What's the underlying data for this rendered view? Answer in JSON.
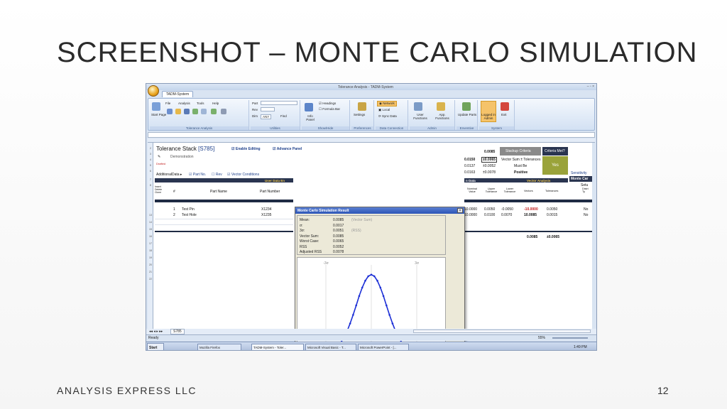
{
  "slide": {
    "title": "SCREENSHOT – MONTE CARLO SIMULATION",
    "footer_left": "ANALYSIS EXPRESS LLC",
    "page_number": "12"
  },
  "window": {
    "title": "Tolerance Analysis - TADM-System"
  },
  "ribbon": {
    "tab": "TADM-System",
    "menus": [
      "File",
      "Analysis",
      "Tools",
      "Help"
    ],
    "groups": [
      "Tolerance Analysis",
      "Utilities",
      "Show/Hide",
      "Preferences",
      "Data Connection",
      "Admin",
      "Enventive",
      "System"
    ],
    "start_page": "Start Page",
    "part_label": "Part",
    "rev_label": "Rev",
    "dim_label": "Dim",
    "dim_value": "ANY",
    "find_label": "Find",
    "info_panel": "Info Panel",
    "headings": "Headings",
    "formula_bar": "Formula Bar",
    "settings": "Settings",
    "network": "Network",
    "local": "Local",
    "sync_data": "Sync Data",
    "user_functions": "User Functions",
    "app_functions": "App. Functions",
    "update_parts": "Update Parts",
    "logged_in": "Logged in Admin",
    "exit": "Exit"
  },
  "sheet": {
    "stack_title": "Tolerance Stack",
    "stack_name": "[S785]",
    "enable_editing": "Enable Editing",
    "advance_panel": "Advance Panel",
    "description": "Demonstration",
    "status": "Drafted",
    "additional_data": "AdditionalData",
    "part_no": "Part No.",
    "rev": "Rev",
    "vector_conditions": "Vector Conditions",
    "user_data_entry": "User Data En",
    "col_insert": "Insert Delete Clone",
    "col_num": "#",
    "col_part_name": "Part Name",
    "col_part_number": "Part Number",
    "rows": [
      {
        "num": "1",
        "name": "Test Pin",
        "part_number": "X1234"
      },
      {
        "num": "2",
        "name": "Test Hole",
        "part_number": "X1235"
      }
    ],
    "right_top": {
      "total": "0.0085",
      "stackup_criteria": "Stackup Criteria",
      "criteria_met": "Criteria Met?",
      "v1": "0.0150",
      "v1b": "±0.0065",
      "vector_sum": "Vector Sum ± Tolerances",
      "v2": "0.0137",
      "v2b": "±0.0052",
      "must_be": "Must Be",
      "v3": "0.0163",
      "v3b": "±0.0078",
      "positive": "Positive",
      "yes": "Yes",
      "sensitivity": "Sensitivity",
      "monte_carlo": "Monte Car",
      "setup": "Setu"
    },
    "right_table": {
      "section_data": "n Data",
      "section_vector": "Vector Analysis",
      "headers": [
        "Nominal Value",
        "Upper Tolerance",
        "Lower Tolerance",
        "Vectors",
        "Tolerances",
        "Distri Ty"
      ],
      "rows": [
        [
          "10.0000",
          "0.0050",
          "-0.0050",
          "-10.0000",
          "0.0050",
          "No"
        ],
        [
          "10.0000",
          "0.0100",
          "0.0070",
          "10.0085",
          "0.0015",
          "No"
        ]
      ],
      "total_vec": "0.0085",
      "total_tol": "±0.0065"
    },
    "sheet_tab": "S785",
    "status_ready": "Ready",
    "zoom": "55%"
  },
  "dialog": {
    "title": "Monte Carlo Simulation Result",
    "stats": [
      {
        "label": "Mean:",
        "value": "0.0085",
        "note": "(Vector Sum)"
      },
      {
        "label": "σ:",
        "value": "0.0017",
        "note": ""
      },
      {
        "label": "3σ:",
        "value": "0.0051",
        "note": "(RSS)"
      },
      {
        "label": "Vector Sum:",
        "value": "0.0085",
        "note": ""
      },
      {
        "label": "Worst Case:",
        "value": "0.0065",
        "note": ""
      },
      {
        "label": "RSS",
        "value": "0.0052",
        "note": ""
      },
      {
        "label": "Adjusted RSS",
        "value": "0.0078",
        "note": ""
      }
    ],
    "minus_3s": "-3σ",
    "plus_3s": "3σ",
    "ok": "OK"
  },
  "chart_data": {
    "type": "scatter",
    "title": "",
    "xlabel": "",
    "ylabel": "",
    "x": [
      -3.4,
      -3.0,
      -2.8,
      -2.6,
      -2.4,
      -2.2,
      -2.0,
      -1.8,
      -1.6,
      -1.4,
      -1.2,
      -1.0,
      -0.8,
      -0.6,
      -0.4,
      -0.2,
      0.0,
      0.2,
      0.4,
      0.6,
      0.8,
      1.0,
      1.2,
      1.4,
      1.6,
      1.8,
      2.0,
      2.2,
      2.4,
      2.6,
      2.8,
      3.0,
      3.2,
      3.4
    ],
    "y": [
      0.001,
      0.004,
      0.008,
      0.014,
      0.022,
      0.035,
      0.054,
      0.079,
      0.111,
      0.15,
      0.194,
      0.242,
      0.29,
      0.333,
      0.368,
      0.391,
      0.399,
      0.391,
      0.368,
      0.333,
      0.29,
      0.242,
      0.194,
      0.15,
      0.111,
      0.079,
      0.054,
      0.035,
      0.022,
      0.014,
      0.008,
      0.004,
      0.002,
      0.001
    ],
    "xlim": [
      -4.5,
      4.5
    ],
    "ylim": [
      0,
      0.42
    ],
    "color": "#1c2fd6"
  },
  "taskbar": {
    "start": "Start",
    "items": [
      "Mozilla Firefox",
      "TADM-System - Toler...",
      "Microsoft Visual Basic - T...",
      "Microsoft PowerPoint - [..."
    ],
    "clock": "1:49 PM"
  }
}
